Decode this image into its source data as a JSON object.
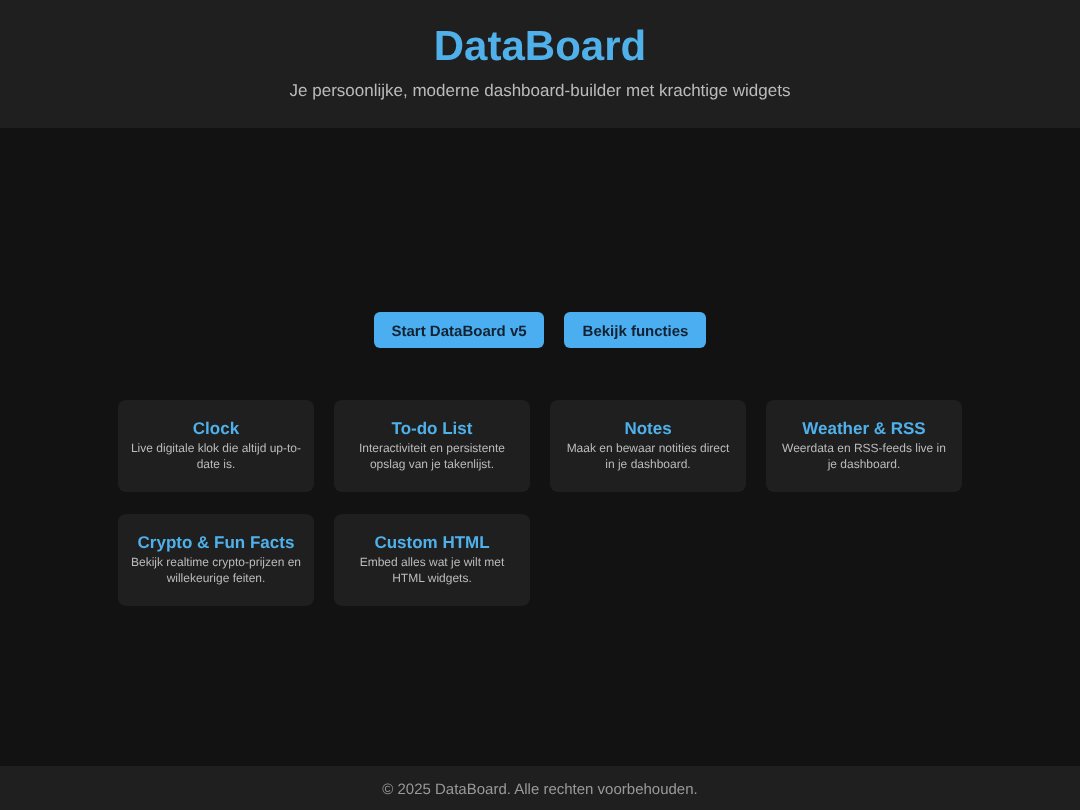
{
  "header": {
    "title": "DataBoard",
    "subtitle": "Je persoonlijke, moderne dashboard-builder met krachtige widgets"
  },
  "buttons": [
    "Start DataBoard v5",
    "Bekijk functies"
  ],
  "features": [
    {
      "title": "Clock",
      "description": "Live digitale klok die altijd up-to-date is."
    },
    {
      "title": "To-do List",
      "description": "Interactiviteit en persistente opslag van je takenlijst."
    },
    {
      "title": "Notes",
      "description": "Maak en bewaar notities direct in je dashboard."
    },
    {
      "title": "Weather & RSS",
      "description": "Weerdata en RSS-feeds live in je dashboard."
    },
    {
      "title": "Crypto & Fun Facts",
      "description": "Bekijk realtime crypto-prijzen en willekeurige feiten."
    },
    {
      "title": "Custom HTML",
      "description": "Embed alles wat je wilt met HTML widgets."
    }
  ],
  "footer": "© 2025 DataBoard. Alle rechten voorbehouden."
}
